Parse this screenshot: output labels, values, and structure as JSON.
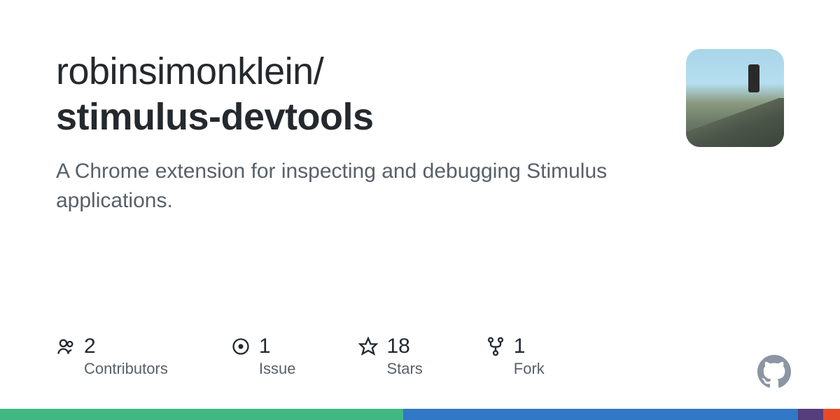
{
  "repo": {
    "owner": "robinsimonklein",
    "name": "stimulus-devtools",
    "description": "A Chrome extension for inspecting and debugging Stimulus applications."
  },
  "stats": {
    "contributors": {
      "count": "2",
      "label": "Contributors"
    },
    "issues": {
      "count": "1",
      "label": "Issue"
    },
    "stars": {
      "count": "18",
      "label": "Stars"
    },
    "forks": {
      "count": "1",
      "label": "Fork"
    }
  },
  "languages": [
    {
      "color": "#41b883",
      "percent": 48
    },
    {
      "color": "#3178c6",
      "percent": 47
    },
    {
      "color": "#563d7c",
      "percent": 3
    },
    {
      "color": "#e34c26",
      "percent": 2
    }
  ]
}
